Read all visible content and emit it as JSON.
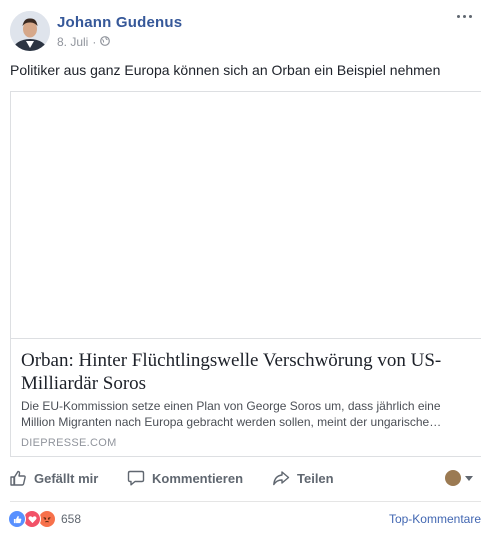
{
  "post": {
    "author": "Johann Gudenus",
    "date": "8. Juli",
    "separator": "·",
    "privacy_icon": "globe-icon",
    "text": "Politiker aus ganz Europa können sich an Orban ein Beispiel nehmen"
  },
  "link_card": {
    "title": "Orban: Hinter Flüchtlingswelle Verschwörung von US-Milliardär Soros",
    "description": "Die EU-Kommission setze einen Plan von George Soros um, dass jährlich eine Million Migranten nach Europa gebracht werden sollen, meint der ungarische…",
    "source": "DIEPRESSE.COM"
  },
  "actions": {
    "like_label": "Gefällt mir",
    "comment_label": "Kommentieren",
    "share_label": "Teilen"
  },
  "reactions": {
    "types": [
      "like",
      "love",
      "angry"
    ],
    "count": "658"
  },
  "comments": {
    "sort_label": "Top-Kommentare"
  },
  "colors": {
    "author_link": "#365899",
    "secondary_text": "#606770",
    "like_blue": "#5890ff",
    "love_red": "#f25268",
    "angry_orange": "#f7714b"
  }
}
